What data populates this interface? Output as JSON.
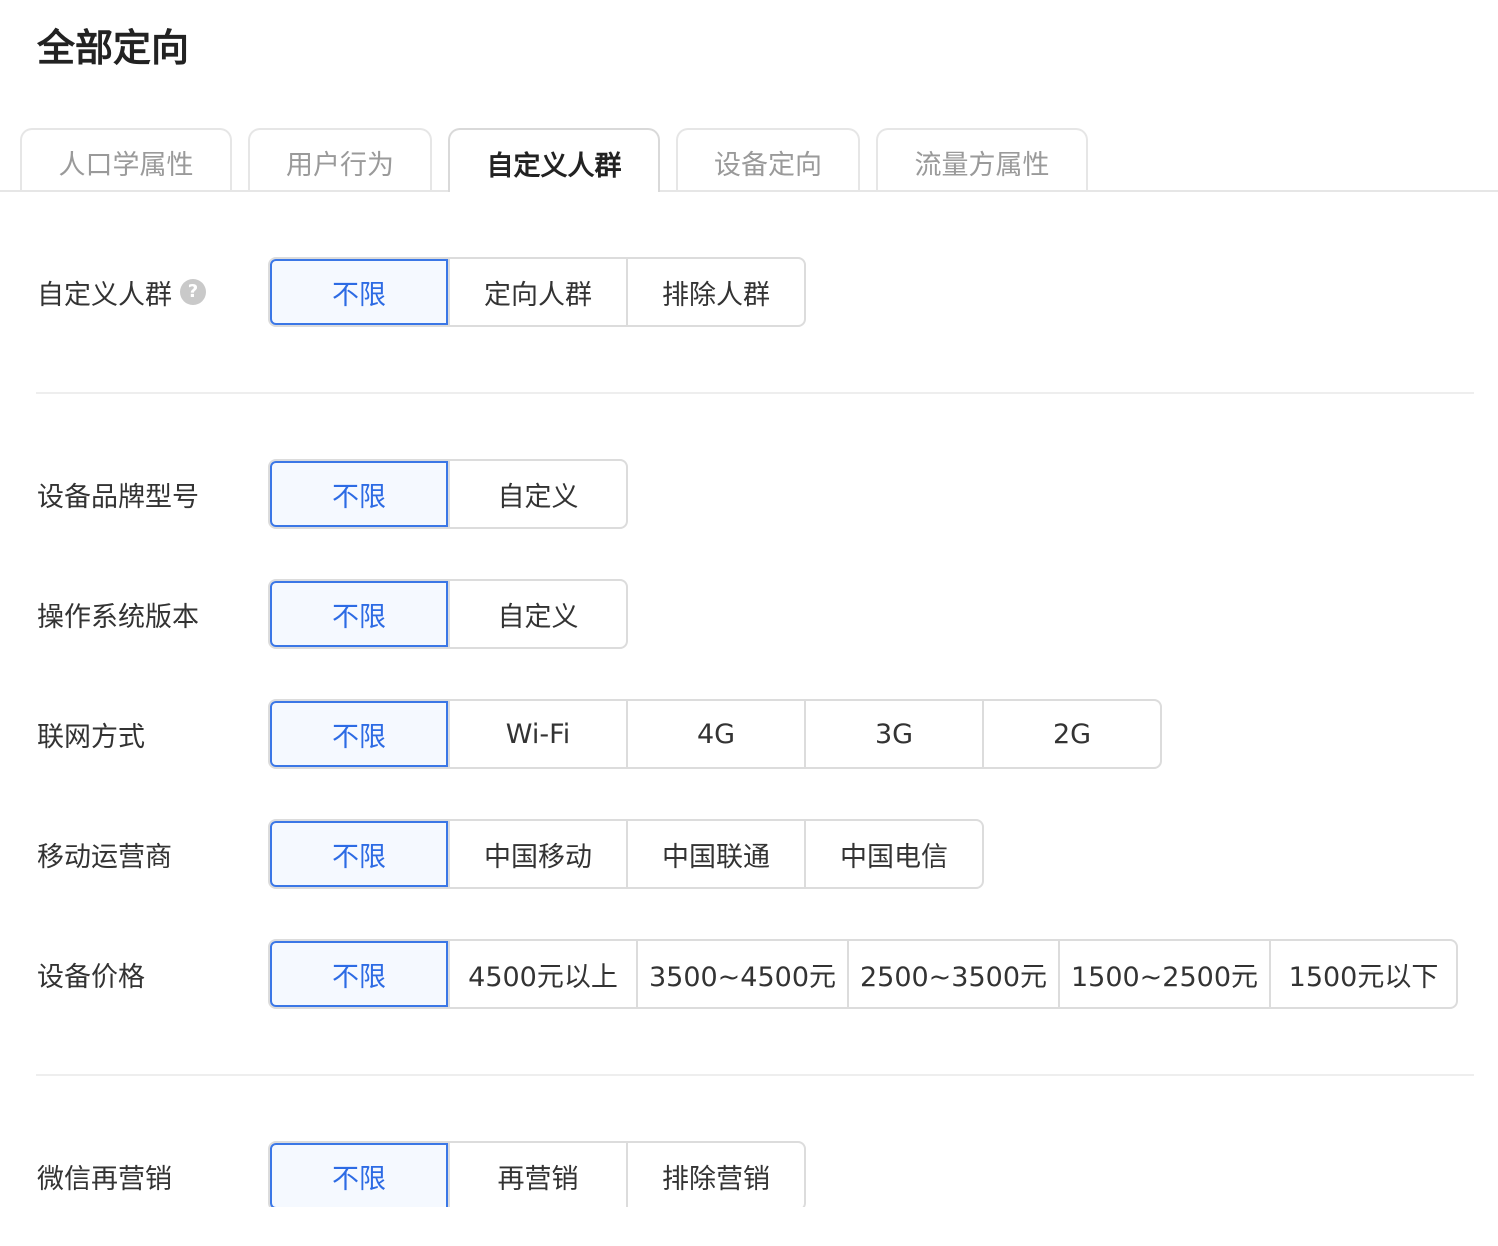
{
  "page": {
    "title": "全部定向"
  },
  "tabs": [
    {
      "label": "人口学属性",
      "active": false
    },
    {
      "label": "用户行为",
      "active": false
    },
    {
      "label": "自定义人群",
      "active": true
    },
    {
      "label": "设备定向",
      "active": false
    },
    {
      "label": "流量方属性",
      "active": false
    }
  ],
  "colors": {
    "accent": "#2d6be4",
    "selected_bg": "#f5f9ff",
    "border": "#dcdcdc"
  },
  "rows": {
    "custom_audience": {
      "label": "自定义人群",
      "help_icon": "question-circle-icon",
      "help_glyph": "?",
      "options": [
        "不限",
        "定向人群",
        "排除人群"
      ],
      "selected": "不限"
    },
    "device_brand": {
      "label": "设备品牌型号",
      "options": [
        "不限",
        "自定义"
      ],
      "selected": "不限"
    },
    "os_version": {
      "label": "操作系统版本",
      "options": [
        "不限",
        "自定义"
      ],
      "selected": "不限"
    },
    "network": {
      "label": "联网方式",
      "options": [
        "不限",
        "Wi-Fi",
        "4G",
        "3G",
        "2G"
      ],
      "selected": "不限"
    },
    "carrier": {
      "label": "移动运营商",
      "options": [
        "不限",
        "中国移动",
        "中国联通",
        "中国电信"
      ],
      "selected": "不限"
    },
    "device_price": {
      "label": "设备价格",
      "options": [
        "不限",
        "4500元以上",
        "3500~4500元",
        "2500~3500元",
        "1500~2500元",
        "1500元以下"
      ],
      "selected": "不限"
    },
    "wechat_remarketing": {
      "label": "微信再营销",
      "options": [
        "不限",
        "再营销",
        "排除营销"
      ],
      "selected": "不限"
    }
  }
}
